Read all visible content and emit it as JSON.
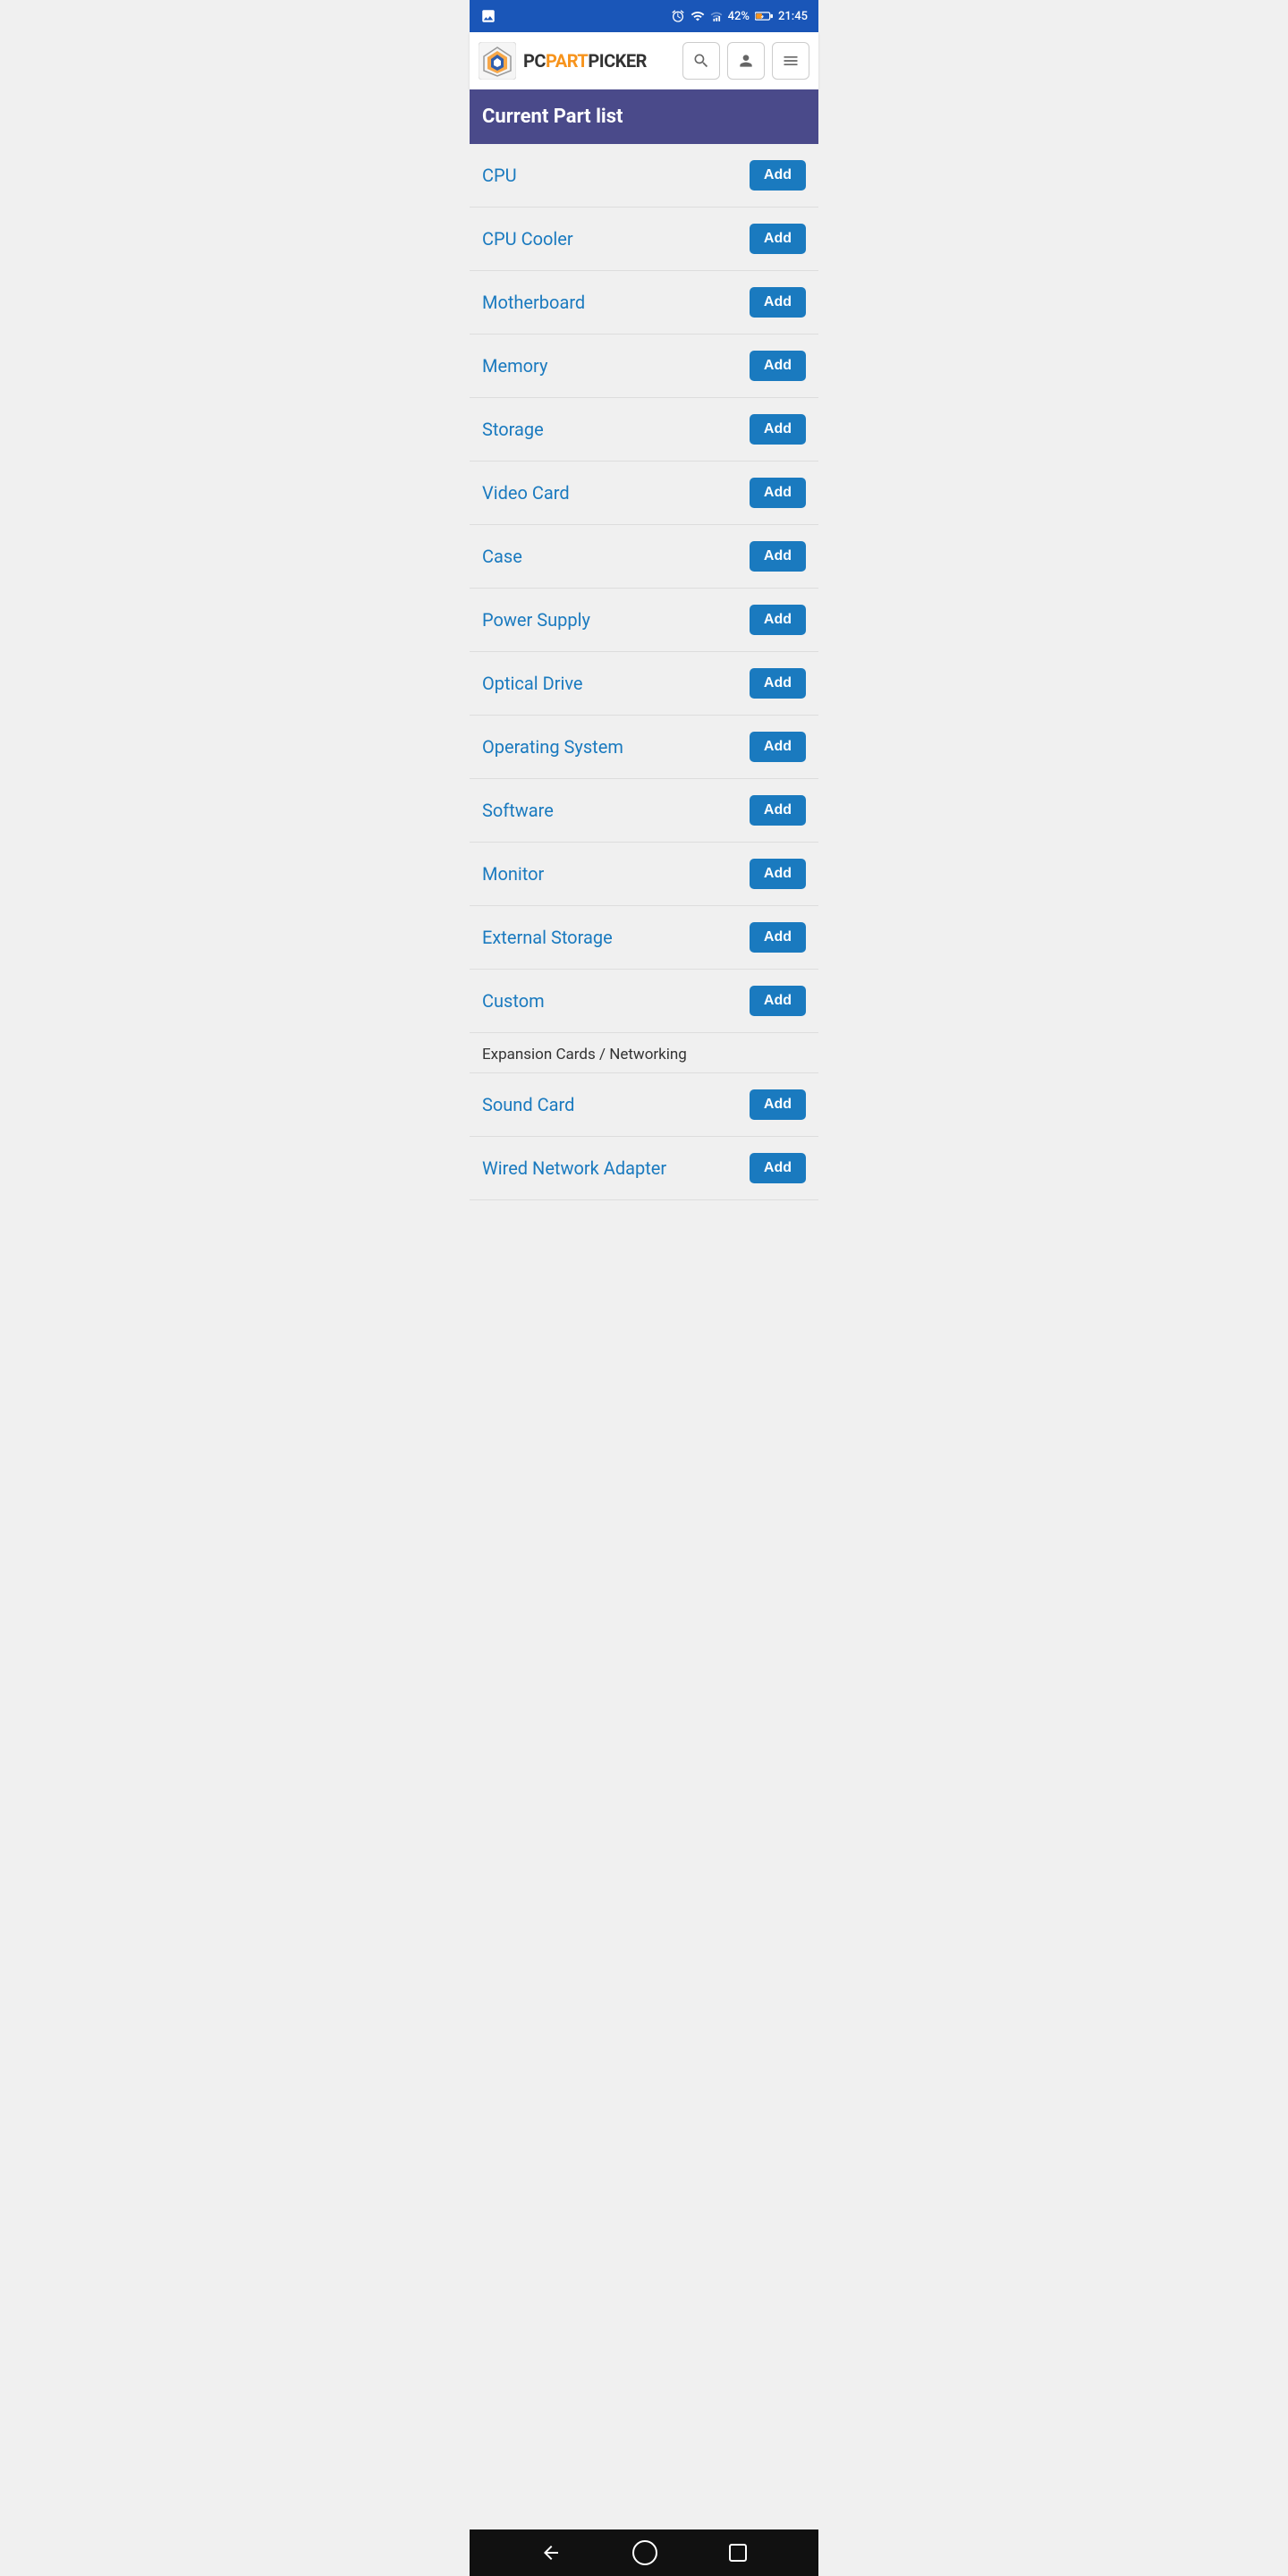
{
  "statusBar": {
    "time": "21:45",
    "battery": "42%",
    "icons": [
      "photo-icon",
      "alarm-icon",
      "wifi-icon",
      "signal-icon",
      "battery-icon"
    ]
  },
  "header": {
    "logoTextPC": "PC",
    "logoTextPart": "PART",
    "logoTextPicker": "PICKER",
    "searchLabel": "Search",
    "profileLabel": "Profile",
    "menuLabel": "Menu"
  },
  "banner": {
    "title": "Current Part list"
  },
  "partList": [
    {
      "id": "cpu",
      "name": "CPU",
      "addLabel": "Add"
    },
    {
      "id": "cpu-cooler",
      "name": "CPU Cooler",
      "addLabel": "Add"
    },
    {
      "id": "motherboard",
      "name": "Motherboard",
      "addLabel": "Add"
    },
    {
      "id": "memory",
      "name": "Memory",
      "addLabel": "Add"
    },
    {
      "id": "storage",
      "name": "Storage",
      "addLabel": "Add"
    },
    {
      "id": "video-card",
      "name": "Video Card",
      "addLabel": "Add"
    },
    {
      "id": "case",
      "name": "Case",
      "addLabel": "Add"
    },
    {
      "id": "power-supply",
      "name": "Power Supply",
      "addLabel": "Add"
    },
    {
      "id": "optical-drive",
      "name": "Optical Drive",
      "addLabel": "Add"
    },
    {
      "id": "operating-system",
      "name": "Operating System",
      "addLabel": "Add"
    },
    {
      "id": "software",
      "name": "Software",
      "addLabel": "Add"
    },
    {
      "id": "monitor",
      "name": "Monitor",
      "addLabel": "Add"
    },
    {
      "id": "external-storage",
      "name": "External Storage",
      "addLabel": "Add"
    },
    {
      "id": "custom",
      "name": "Custom",
      "addLabel": "Add"
    }
  ],
  "expansionSection": {
    "title": "Expansion Cards / Networking"
  },
  "expansionItems": [
    {
      "id": "sound-card",
      "name": "Sound Card",
      "addLabel": "Add"
    },
    {
      "id": "wired-network-adapter",
      "name": "Wired Network Adapter",
      "addLabel": "Add"
    }
  ],
  "navBar": {
    "backLabel": "Back",
    "homeLabel": "Home",
    "recentLabel": "Recent"
  }
}
